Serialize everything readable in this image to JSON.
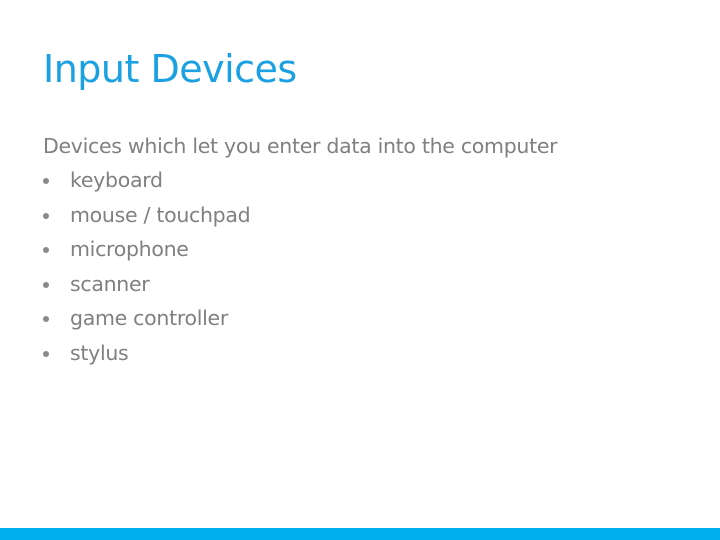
{
  "slide": {
    "title": "Input Devices",
    "intro": "Devices which let you enter data into the computer",
    "bullets": [
      {
        "label": "keyboard"
      },
      {
        "label": "mouse / touchpad"
      },
      {
        "label": "microphone"
      },
      {
        "label": "scanner"
      },
      {
        "label": "game controller"
      },
      {
        "label": "stylus"
      }
    ],
    "bullet_icon": "bullet-dot-icon"
  },
  "colors": {
    "title": "#1ba1e2",
    "body_text": "#808080",
    "accent_bar": "#00aeef",
    "background": "#ffffff"
  }
}
